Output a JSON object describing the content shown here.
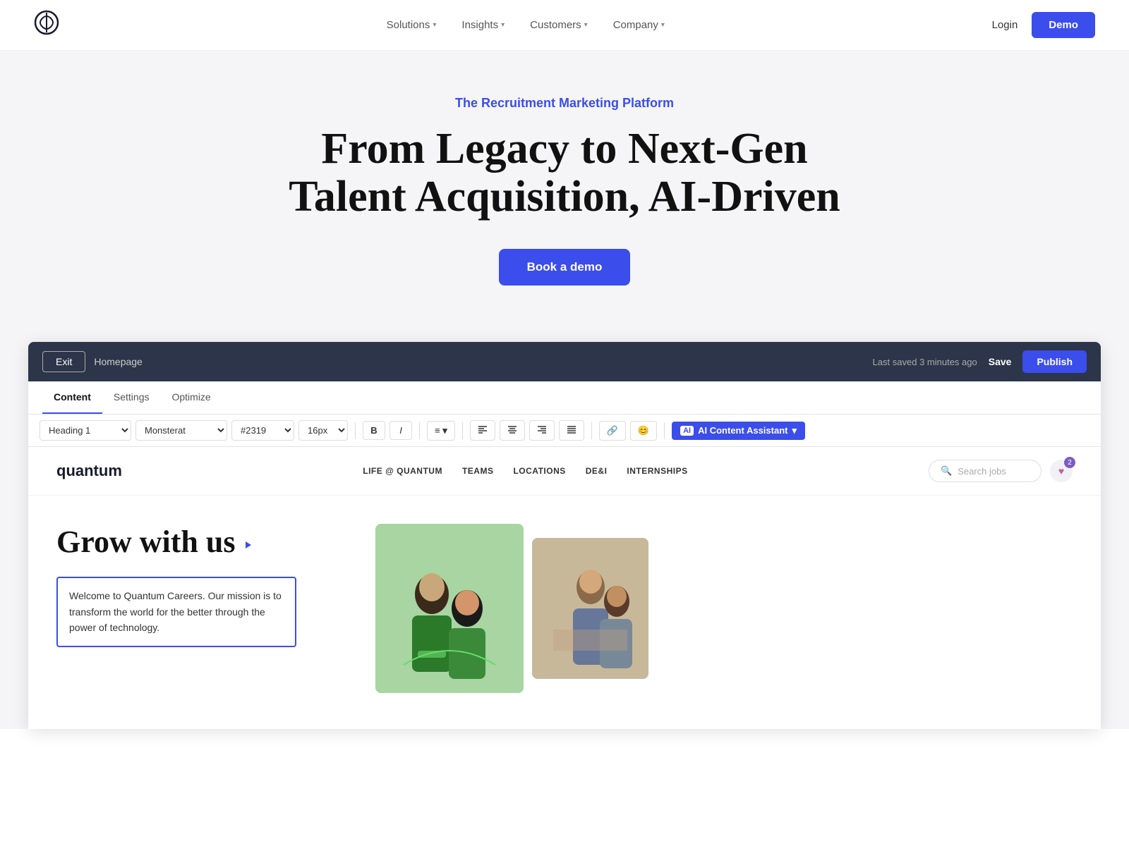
{
  "nav": {
    "logo_symbol": "⊗",
    "links": [
      {
        "label": "Solutions",
        "has_chevron": true
      },
      {
        "label": "Insights",
        "has_chevron": true
      },
      {
        "label": "Customers",
        "has_chevron": true
      },
      {
        "label": "Company",
        "has_chevron": true
      }
    ],
    "login_label": "Login",
    "demo_label": "Demo"
  },
  "hero": {
    "subtitle": "The Recruitment Marketing Platform",
    "title": "From Legacy to Next-Gen Talent Acquisition, AI-Driven",
    "cta_label": "Book a demo"
  },
  "editor": {
    "topbar": {
      "exit_label": "Exit",
      "page_label": "Homepage",
      "last_saved": "Last saved 3 minutes ago",
      "save_label": "Save",
      "publish_label": "Publish"
    },
    "tabs": [
      {
        "label": "Content",
        "active": true
      },
      {
        "label": "Settings",
        "active": false
      },
      {
        "label": "Optimize",
        "active": false
      }
    ],
    "toolbar": {
      "heading_value": "Heading 1",
      "font_value": "Monsterat",
      "color_value": "#2319",
      "size_value": "16px",
      "bold_label": "B",
      "italic_label": "I",
      "list_label": "≡",
      "align_left": "≡",
      "align_center": "≡",
      "align_right": "≡",
      "align_justify": "≡",
      "link_label": "🔗",
      "emoji_label": "😊",
      "ai_label": "AI Content Assistant"
    }
  },
  "site_preview": {
    "logo": "quantum",
    "nav_links": [
      {
        "label": "LIFE @ QUANTUM"
      },
      {
        "label": "TEAMS"
      },
      {
        "label": "LOCATIONS"
      },
      {
        "label": "DE&I"
      },
      {
        "label": "INTERNSHIPS"
      }
    ],
    "search_placeholder": "Search jobs",
    "heart_count": "2",
    "hero_title": "Grow with us",
    "body_text": "Welcome to Quantum Careers. Our mission is to transform the world for the better through the power of technology.",
    "cursor_visible": true
  }
}
